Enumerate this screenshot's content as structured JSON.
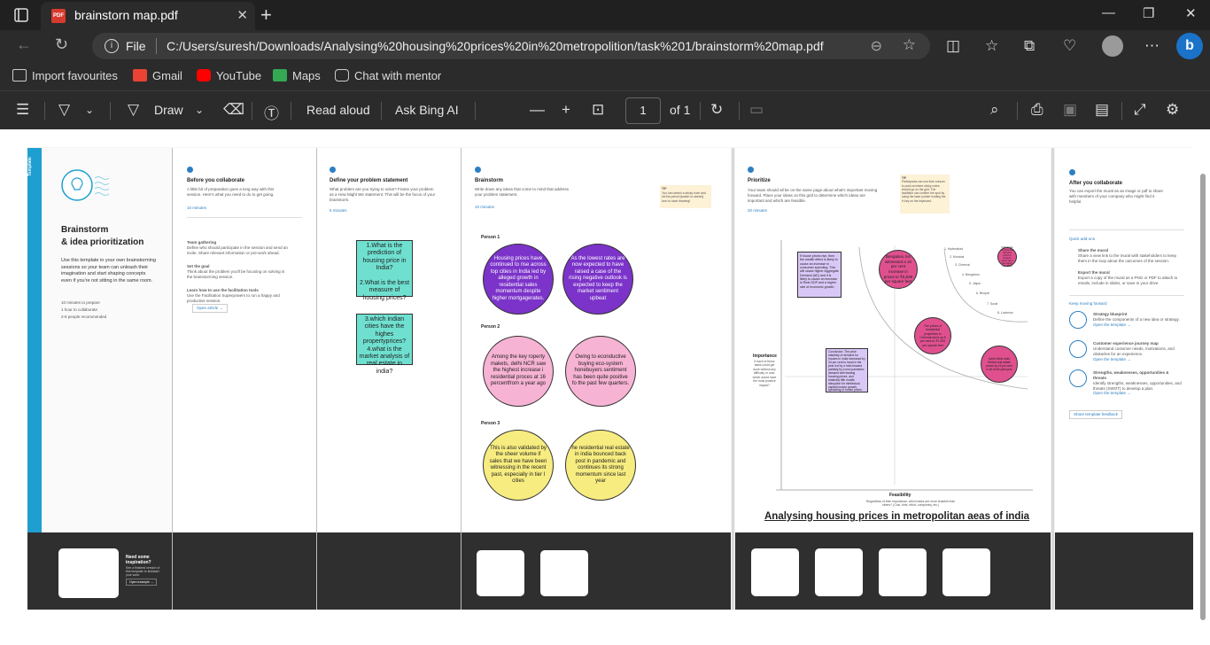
{
  "tab": {
    "title": "brainstorn map.pdf",
    "close": "✕",
    "new": "+"
  },
  "window": {
    "minimize": "—",
    "maximize": "❐",
    "close": "✕"
  },
  "address": {
    "scheme_label": "File",
    "url": "C:/Users/suresh/Downloads/Analysing%20housing%20prices%20in%20metropolition/task%201/brainstorm%20map.pdf"
  },
  "favourites": [
    {
      "label": "Import favourites",
      "icon": "import-icon",
      "color": "#cccccc"
    },
    {
      "label": "Gmail",
      "icon": "gmail-icon",
      "color": "#ea4335"
    },
    {
      "label": "YouTube",
      "icon": "youtube-icon",
      "color": "#ff0000"
    },
    {
      "label": "Maps",
      "icon": "maps-icon",
      "color": "#34a853"
    },
    {
      "label": "Chat with mentor",
      "icon": "chat-icon",
      "color": "#cccccc"
    }
  ],
  "pdf_toolbar": {
    "draw": "Draw",
    "read_aloud": "Read aloud",
    "ask_bing": "Ask Bing AI",
    "page_current": "1",
    "page_total": "of 1"
  },
  "doc": {
    "template_label": "Template",
    "intro": {
      "title_line1": "Brainstorm",
      "title_line2": "& idea prioritization",
      "body": "Use this template in your own brainstorming sessions so your team can unleash their imagination and start shaping concepts even if you're not sitting in the same room.",
      "time1": "10 minutes to prepare",
      "time2": "1 hour to collaborate",
      "time3": "2-8 people recommended"
    },
    "collab": {
      "title": "Before you collaborate",
      "body": "A little bit of preparation goes a long way with this session. Here's what you need to do to get going.",
      "time": "10 minutes",
      "a_title": "Team gathering",
      "a_body": "Define who should participate in the session and send an invite. Share relevant information or pre-work ahead.",
      "b_title": "Set the goal",
      "b_body": "Think about the problem you'll be focusing on solving in the brainstorming session.",
      "c_title": "Learn how to use the facilitation tools",
      "c_body": "Use the Facilitation Superpowers to run a happy and productive session.",
      "link": "Open article →"
    },
    "define": {
      "title": "Define your problem statement",
      "body": "What problem are you trying to solve? Frame your problem as a How Might We statement. This will be the focus of your brainstorm.",
      "time": "5 minutes",
      "sticky1": "1.What is the prediction of housing price in India?\n\n2.What is the best measure of housing prices?",
      "sticky2": "3.which indian cities have the highes propertyprices?\n4.what is the market analysis of real estate in india?"
    },
    "brainstorm": {
      "title": "Brainstorm",
      "body": "Write down any ideas that come to mind that address your problem statement.",
      "time": "10 minutes",
      "tip": "You can select a sticky note and hit the pencil [switch to sketch] icon to start drawing!",
      "tip_label": "TIP",
      "person1": "Person 1",
      "person2": "Person 2",
      "person3": "Person 3",
      "p1a": "Housing prices have continued to rise across top cities in India led by alleged growth in residential sales momentum despite higher mortgagerates.",
      "p1b": "As the lowest rates are now expected to have raised a case of the rising negative outlook is expected to keep the market sentiment upbeat",
      "p2a": "Among the key roperty makets, delhi NCR saw the highest increase i residential proces at 16 percentfrom a year ago",
      "p2b": "Owing to econductive buying eco-system honebuyers sentiment has been quite positive fo the past few quarters.",
      "p3a": "This is also validated by the sheer volume if sales that we have been witnessing in the recent past, especially in tier I cities",
      "p3b": "he residential real estate in india bounced back post in pandemic and continues its strong momentum since last year"
    },
    "prioritize": {
      "title": "Prioritize",
      "body": "Your team should all be on the same page about what's important moving forward. Place your ideas on this grid to determine which ideas are important and which are feasible.",
      "time": "20 minutes",
      "tip_label": "TIP",
      "tip": "Participants can use their cursors to point at where sticky notes should go on the grid. The facilitator can confirm the spot by using the laser pointer holding the H key on the keyboard.",
      "y_label": "Importance",
      "y_sub": "If each of these tasks could get done without any difficulty or cost, which would have the most positive impact?",
      "x_label": "Feasibility",
      "x_sub": "Regardless of their importance, which tasks are more feasible than others? (Cost, time, effort, complexity, etc.)",
      "note_left": "If house prices rise, then the wealth effect is likely to cause an increase in consumer spending. This will cause higher Aggregate Demand (AD) and it is likely to cause an increase in Real GDP and a higher rate of economic growth.",
      "note_box": "Conclusion: The price elasticity of demand for houses in India increased by 34 per cent to hand in the year led by a hold-forward partially by a new pandemic demand with leading housing prices, and relatively fifth mobile disruption for intellectual capital income growth, spreading of house prices.",
      "c1": "Bengaluru too witnessed a 10 per cent increase in prices to ₹6,638 per square feet",
      "c2": "The prices of residential properties in Chennai went up 8 per cent to ₹7,000 per square feet",
      "c3": "Kolkata has the price and Mumbai prices in property sector seen this higher than listed",
      "c4": "North-West India Reflect real estate prices by 16 per cent in all of the past year",
      "cities": [
        "1. Hyderabad",
        "2. Mumbai",
        "3. Chennai",
        "4. Bengaluru",
        "5. Jaipur",
        "6. Bhopal",
        "7. Surat",
        "8. Lucknow"
      ],
      "caption": "Analysing housing prices in metropolitan aeas of india"
    },
    "after": {
      "title": "After you collaborate",
      "body": "You can export the mural as an image or pdf to share with members of your company who might find it helpful.",
      "quick_add": "Quick add-ons",
      "a_title": "Share the mural",
      "a_body": "Share a view link to the mural with stakeholders to keep them in the loop about the outcomes of the session.",
      "b_title": "Export the mural",
      "b_body": "Export a copy of the mural as a PNG or PDF to attach to emails, include in slides, or save in your drive.",
      "keep": "Keep moving forward",
      "k1_title": "Strategy blueprint",
      "k1_body": "Define the components of a new idea or strategy.",
      "k2_title": "Customer experience journey map",
      "k2_body": "Understand customer needs, motivations, and obstacles for an experience.",
      "k3_title": "Strengths, weaknesses, opportunities & threats",
      "k3_body": "Identify strengths, weaknesses, opportunities, and threats (SWOT) to develop a plan.",
      "open_template": "Open the template →",
      "feedback": "Share template feedback"
    },
    "inspiration": {
      "title": "Need some inspiration?",
      "body": "See a finished version of this template to kickstart your work.",
      "button": "Open example →"
    }
  }
}
